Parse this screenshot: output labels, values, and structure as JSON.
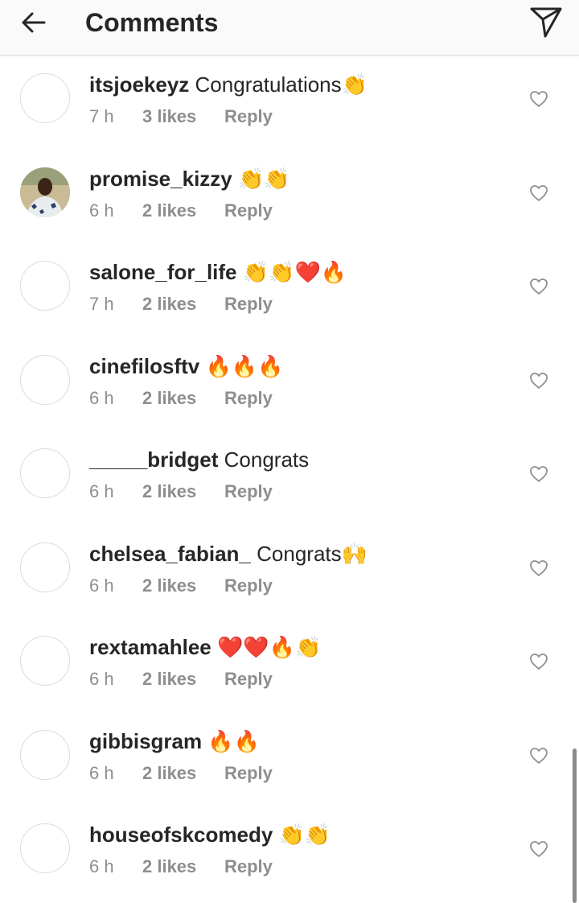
{
  "header": {
    "title": "Comments",
    "back_icon": "arrow-left-icon",
    "send_icon": "paper-plane-icon"
  },
  "comments": [
    {
      "username": "itsjoekeyz",
      "text": "Congratulations",
      "emoji": "👏",
      "time": "7 h",
      "likes": "3 likes",
      "reply": "Reply",
      "avatar": "empty"
    },
    {
      "username": "promise_kizzy",
      "text": "",
      "emoji": "👏👏",
      "time": "6 h",
      "likes": "2 likes",
      "reply": "Reply",
      "avatar": "photo"
    },
    {
      "username": "salone_for_life",
      "text": "",
      "emoji": "👏👏❤️🔥",
      "time": "7 h",
      "likes": "2 likes",
      "reply": "Reply",
      "avatar": "empty"
    },
    {
      "username": "cinefilosftv",
      "text": "",
      "emoji": "🔥🔥🔥",
      "time": "6 h",
      "likes": "2 likes",
      "reply": "Reply",
      "avatar": "empty"
    },
    {
      "username": "_____bridget",
      "text": "Congrats",
      "emoji": "",
      "time": "6 h",
      "likes": "2 likes",
      "reply": "Reply",
      "avatar": "empty"
    },
    {
      "username": "chelsea_fabian_",
      "text": "Congrats",
      "emoji": "🙌",
      "time": "6 h",
      "likes": "2 likes",
      "reply": "Reply",
      "avatar": "empty"
    },
    {
      "username": "rextamahlee",
      "text": "",
      "emoji": "❤️❤️🔥👏",
      "time": "6 h",
      "likes": "2 likes",
      "reply": "Reply",
      "avatar": "empty"
    },
    {
      "username": "gibbisgram",
      "text": "",
      "emoji": "🔥🔥",
      "time": "6 h",
      "likes": "2 likes",
      "reply": "Reply",
      "avatar": "empty"
    },
    {
      "username": "houseofskcomedy",
      "text": "",
      "emoji": "👏👏",
      "time": "6 h",
      "likes": "2 likes",
      "reply": "Reply",
      "avatar": "empty"
    }
  ],
  "icons": {
    "like": "heart-outline-icon"
  },
  "colors": {
    "primary_text": "#262626",
    "secondary_text": "#8e8e8e",
    "border": "#dbdbdb"
  }
}
